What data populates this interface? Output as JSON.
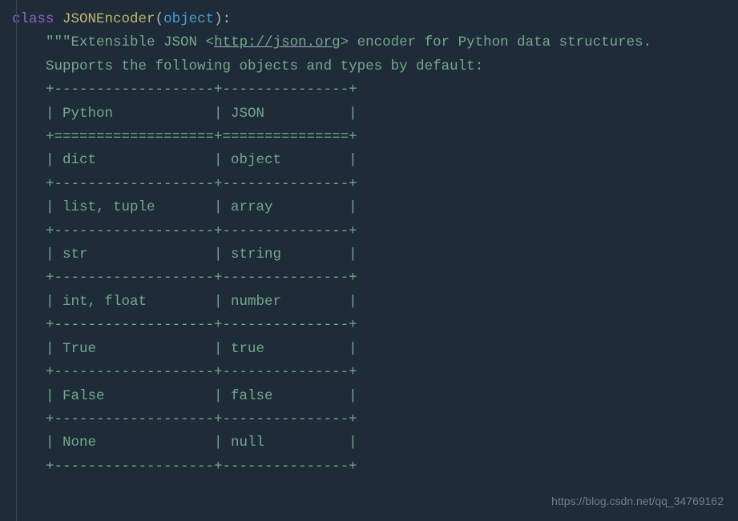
{
  "code": {
    "keyword_class": "class",
    "space1": " ",
    "class_name": "JSONEncoder",
    "paren_open": "(",
    "builtin_object": "object",
    "paren_close": ")",
    "colon": ":",
    "indent1": "    ",
    "docstring_open": "\"\"\"",
    "doc_line1_a": "Extensible JSON <",
    "doc_line1_url": "http://json.org",
    "doc_line1_b": "> encoder for Python data structures.",
    "doc_blank": "",
    "doc_supports": "    Supports the following objects and types by default:",
    "table_sep_dash": "    +-------------------+---------------+",
    "table_header": "    | Python            | JSON          |",
    "table_sep_eq": "    +===================+===============+",
    "row_dict": "    | dict              | object        |",
    "row_list": "    | list, tuple       | array         |",
    "row_str": "    | str               | string        |",
    "row_int": "    | int, float        | number        |",
    "row_true": "    | True              | true          |",
    "row_false": "    | False             | false         |",
    "row_none": "    | None              | null          |"
  },
  "watermark": "https://blog.csdn.net/qq_34769162"
}
